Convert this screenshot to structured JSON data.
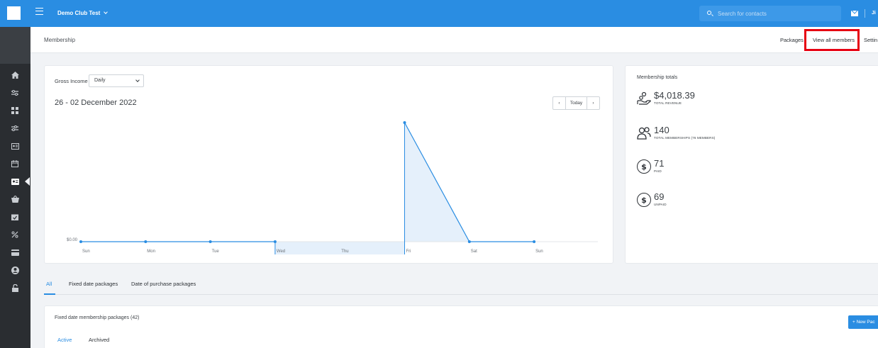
{
  "topbar": {
    "club_name": "Demo Club Test",
    "search_placeholder": "Search for contacts",
    "user_initials": "Ji"
  },
  "sidebar": {
    "icons": [
      "home-icon",
      "sliders-icon",
      "grid-icon",
      "sliders-icon",
      "contact-card-icon",
      "calendar-icon",
      "membership-card-icon",
      "basket-icon",
      "calendar-check-icon",
      "percent-icon",
      "credit-card-icon",
      "account-icon",
      "lock-icon"
    ],
    "active": "membership-card-icon"
  },
  "header": {
    "title": "Membership",
    "links": {
      "packages": "Packages",
      "view_all_members": "View all members",
      "settings": "Settin"
    }
  },
  "chart_card": {
    "gross_income_label": "Gross Income",
    "period_select": "Daily",
    "date_range": "26 - 02 December 2022",
    "prev_symbol": "‹",
    "today_label": "Today",
    "next_symbol": "›"
  },
  "chart_data": {
    "type": "line",
    "categories": [
      "Sun",
      "Mon",
      "Tue",
      "Wed",
      "Thu",
      "Fri",
      "Sat",
      "Sun"
    ],
    "y_tick_labels": [
      "$0.00"
    ],
    "series": [
      {
        "values": [
          0,
          0,
          0,
          0,
          null,
          4018.39,
          0,
          0
        ],
        "color": "#2a8de2"
      }
    ],
    "highlight_range": [
      "Wed",
      "Fri"
    ],
    "grid": false
  },
  "totals": {
    "title": "Membership totals",
    "rows": [
      {
        "value": "$4,018.39",
        "label": "TOTAL REVENUE",
        "icon": "hand-coin-icon"
      },
      {
        "value": "140",
        "label": "TOTAL MEMBERSHIPS (76 MEMBERS)",
        "icon": "users-icon"
      },
      {
        "value": "71",
        "label": "PAID",
        "icon": "dollar-coin-icon",
        "symbol": "$"
      },
      {
        "value": "69",
        "label": "UNPAID",
        "icon": "dollar-coin-icon",
        "symbol": "$"
      }
    ]
  },
  "tabs": {
    "all": "All",
    "fixed_date": "Fixed date packages",
    "date_of_purchase": "Date of purchase packages"
  },
  "packages": {
    "title": "Fixed date membership packages (42)",
    "new_button": "+ New Pac",
    "sub_tabs": {
      "active": "Active",
      "archived": "Archived"
    }
  },
  "colors": {
    "accent": "#2a8de2",
    "sidebar": "#2a2d31",
    "highlight_box": "#e60012",
    "chart_fill": "#e5f0fb"
  }
}
